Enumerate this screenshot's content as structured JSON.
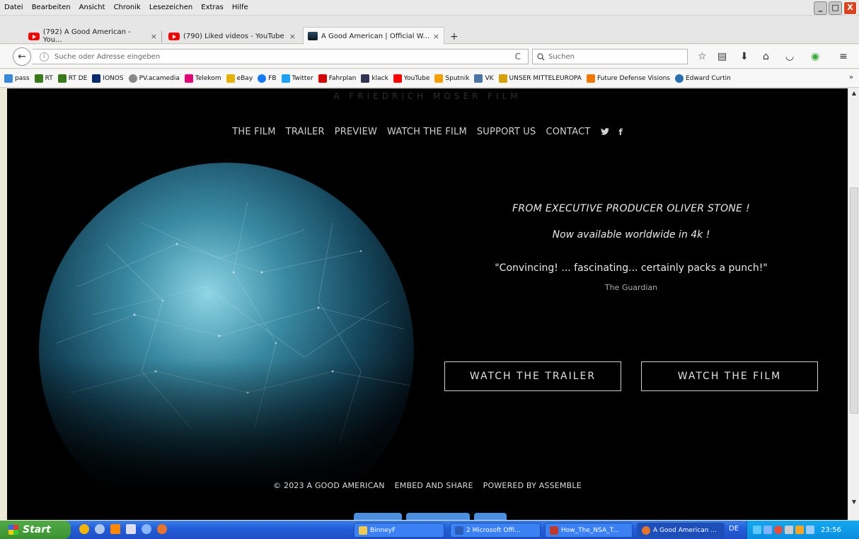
{
  "menubar": {
    "items": [
      "Datei",
      "Bearbeiten",
      "Ansicht",
      "Chronik",
      "Lesezeichen",
      "Extras",
      "Hilfe"
    ]
  },
  "tabs": [
    {
      "title": "(792) A Good American - You...",
      "active": false
    },
    {
      "title": "(790) Liked videos - YouTube",
      "active": false
    },
    {
      "title": "A Good American | Official W...",
      "active": true
    }
  ],
  "tab_close_glyph": "×",
  "newtab_glyph": "+",
  "navbar": {
    "url_placeholder": "Suche oder Adresse eingeben",
    "search_placeholder": "Suchen"
  },
  "bookmarks": [
    {
      "label": "pass",
      "color": "#3b8ad9"
    },
    {
      "label": "RT",
      "color": "#3a7a1a"
    },
    {
      "label": "RT DE",
      "color": "#3a7a1a"
    },
    {
      "label": "IONOS",
      "color": "#0b2a6b"
    },
    {
      "label": "PV.acamedia",
      "color": "#888888"
    },
    {
      "label": "Telekom",
      "color": "#e20074"
    },
    {
      "label": "eBay",
      "color": "#e8b000"
    },
    {
      "label": "FB",
      "color": "#1877f2"
    },
    {
      "label": "Twitter",
      "color": "#1da1f2"
    },
    {
      "label": "Fahrplan",
      "color": "#d40000"
    },
    {
      "label": "klack",
      "color": "#333355"
    },
    {
      "label": "YouTube",
      "color": "#ff0000"
    },
    {
      "label": "Sputnik",
      "color": "#f5a000"
    },
    {
      "label": "VK",
      "color": "#4c75a3"
    },
    {
      "label": "UNSER MITTELEUROPA",
      "color": "#d8a000"
    },
    {
      "label": "Future Defense Visions",
      "color": "#f07800"
    },
    {
      "label": "Edward Curtin",
      "color": "#2a6fb0"
    }
  ],
  "bookmarks_more": "»",
  "site": {
    "film_by": "A FRIEDRICH MOSER FILM",
    "nav": [
      "THE FILM",
      "TRAILER",
      "PREVIEW",
      "WATCH THE FILM",
      "SUPPORT US",
      "CONTACT"
    ],
    "tagline1": "FROM EXECUTIVE PRODUCER OLIVER STONE !",
    "tagline2": "Now available worldwide in 4k !",
    "quote": "\"Convincing! ... fascinating... certainly packs a punch!\"",
    "quote_source": "The Guardian",
    "btn_trailer": "WATCH THE TRAILER",
    "btn_film": "WATCH THE FILM",
    "footer": [
      "© 2023 A GOOD AMERICAN",
      "EMBED AND SHARE",
      "POWERED BY ASSEMBLE"
    ]
  },
  "taskbar": {
    "start": "Start",
    "tasks": [
      {
        "label": "BinneyF",
        "color": "#f2c94c"
      },
      {
        "label": "2 Microsoft Offi...",
        "color": "#2b5cb8"
      },
      {
        "label": "How_The_NSA_T...",
        "color": "#c0392b"
      },
      {
        "label": "A Good American ...",
        "color": "#e8742c"
      }
    ],
    "lang": "DE",
    "clock": "23:56"
  }
}
